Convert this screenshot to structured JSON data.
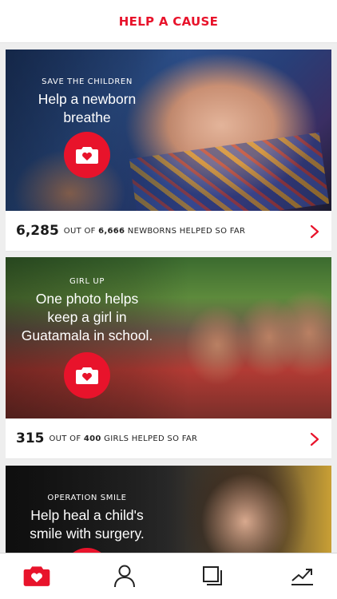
{
  "header": {
    "title": "HELP A CAUSE"
  },
  "colors": {
    "accent": "#e8132b"
  },
  "cards": [
    {
      "org": "SAVE THE CHILDREN",
      "headline": "Help a newborn\nbreathe",
      "count": "6,285",
      "out_of_label": "OUT OF",
      "goal": "6,666",
      "unit_label": "NEWBORNS HELPED SO FAR"
    },
    {
      "org": "GIRL UP",
      "headline": "One photo helps\nkeep a girl in\nGuatamala in school.",
      "count": "315",
      "out_of_label": "OUT OF",
      "goal": "400",
      "unit_label": "GIRLS HELPED SO FAR"
    },
    {
      "org": "OPERATION SMILE",
      "headline": "Help heal a child's\nsmile with surgery."
    }
  ],
  "icons": {
    "camera": "camera-heart-icon",
    "chevron": "chevron-right-icon",
    "tabs": [
      "camera-heart-icon",
      "person-icon",
      "gallery-icon",
      "trend-chart-icon"
    ]
  }
}
